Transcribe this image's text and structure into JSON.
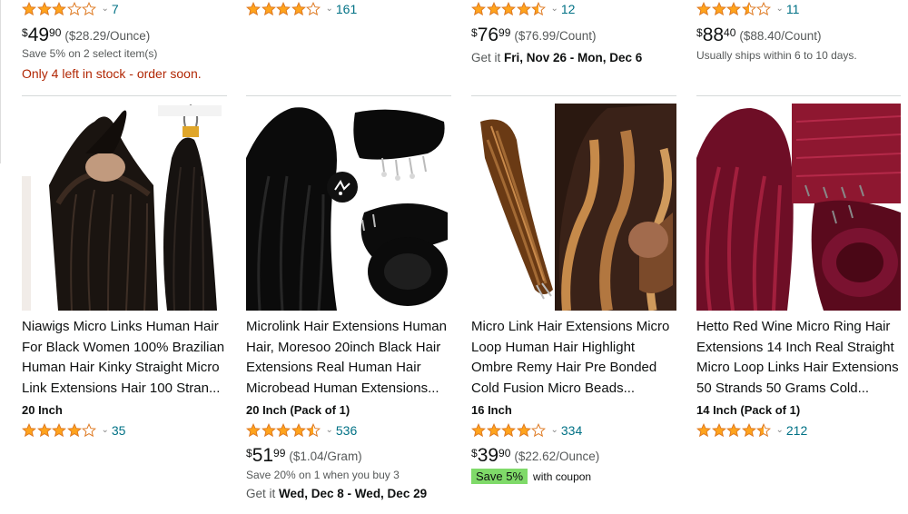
{
  "colors": {
    "link": "#007185",
    "star": "#ffa41c",
    "stock": "#b12704",
    "badge": "#7fda69"
  },
  "top_row": [
    {
      "rating": 3.0,
      "reviews": "7",
      "currency": "$",
      "whole": "49",
      "frac": "90",
      "unit_price": "($28.29/Ounce)",
      "save_text": "Save 5% on 2 select item(s)",
      "stock_text": "Only 4 left in stock - order soon."
    },
    {
      "rating": 4.0,
      "reviews": "161"
    },
    {
      "rating": 4.5,
      "reviews": "12",
      "currency": "$",
      "whole": "76",
      "frac": "99",
      "unit_price": "($76.99/Count)",
      "delivery_prefix": "Get it",
      "delivery_dates": "Fri, Nov 26 - Mon, Dec 6"
    },
    {
      "rating": 3.5,
      "reviews": "11",
      "currency": "$",
      "whole": "88",
      "frac": "40",
      "unit_price": "($88.40/Count)",
      "ship_text": "Usually ships within 6 to 10 days."
    }
  ],
  "products": [
    {
      "title": "Niawigs Micro Links Human Hair For Black Women 100% Brazilian Human Hair Kinky Straight Micro Link Extensions Hair 100 Stran...",
      "size": "20 Inch",
      "rating": 4.0,
      "reviews": "35"
    },
    {
      "title": "Microlink Hair Extensions Human Hair, Moresoo 20inch Black Hair Extensions Real Human Hair Microbead Human Extensions...",
      "size": "20 Inch (Pack of 1)",
      "rating": 4.5,
      "reviews": "536",
      "currency": "$",
      "whole": "51",
      "frac": "99",
      "unit_price": "($1.04/Gram)",
      "save_text": "Save 20% on 1 when you buy 3",
      "delivery_prefix": "Get it",
      "delivery_dates": "Wed, Dec 8 - Wed, Dec 29"
    },
    {
      "title": "Micro Link Hair Extensions Micro Loop Human Hair Highlight Ombre Remy Hair Pre Bonded Cold Fusion Micro Beads...",
      "size": "16 Inch",
      "rating": 4.0,
      "reviews": "334",
      "currency": "$",
      "whole": "39",
      "frac": "90",
      "unit_price": "($22.62/Ounce)",
      "coupon_badge": "Save 5%",
      "coupon_text": "with coupon"
    },
    {
      "title": "Hetto Red Wine Micro Ring Hair Extensions 14 Inch Real Straight Micro Loop Links Hair Extensions 50 Strands 50 Grams Cold...",
      "size": "14 Inch (Pack of 1)",
      "rating": 4.5,
      "reviews": "212"
    }
  ],
  "images": [
    {
      "icon": "product-image-niawigs",
      "palette": [
        "#3a2a22",
        "#15100c",
        "#f0e8e0"
      ]
    },
    {
      "icon": "product-image-moresoo",
      "palette": [
        "#0a0a0a",
        "#1c1c1c",
        "#ffffff"
      ]
    },
    {
      "icon": "product-image-micro-loop-ombre",
      "palette": [
        "#6b3b16",
        "#c98a4a",
        "#2a1a12"
      ]
    },
    {
      "icon": "product-image-hetto-red-wine",
      "palette": [
        "#6d0f24",
        "#9b1d38",
        "#3a0712"
      ]
    }
  ]
}
